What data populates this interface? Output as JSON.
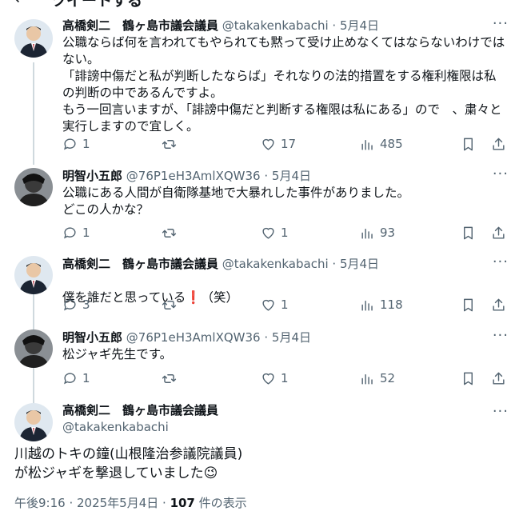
{
  "header": {
    "back_icon": "back-arrow-icon",
    "title": "ツイートする"
  },
  "colors": {
    "text": "#0f1419",
    "muted": "#536471",
    "line": "#cfd9de",
    "accent": "#e0245e"
  },
  "tweets": [
    {
      "name": "高橋剣二　鶴ヶ島市議会議員",
      "handle": "@takakenkabachi",
      "dot": "·",
      "date": "5月4日",
      "more": "···",
      "text": "公職ならば何を言われてもやられても黙って受け止めなくてはならないわけではない。\n「誹謗中傷だと私が判断したならば」それなりの法的措置をする権利権限は私の判断の中であるんですよ。\nもう一回言いますが、「誹謗中傷だと判断する権限は私にある」ので　、粛々と実行しますので宜しく。",
      "reply_count": "1",
      "retweet_count": "",
      "like_count": "17",
      "view_count": "485"
    },
    {
      "name": "明智小五郎",
      "handle": "@76P1eH3AmlXQW36",
      "dot": "·",
      "date": "5月4日",
      "more": "···",
      "text": "公職にある人間が自衛隊基地で大暴れした事件がありました。\nどこの人かな？",
      "reply_count": "1",
      "retweet_count": "",
      "like_count": "1",
      "view_count": "93"
    },
    {
      "name": "高橋剣二　鶴ヶ島市議会議員",
      "handle": "@takakenkabachi",
      "dot": "·",
      "date": "5月4日",
      "more": "···",
      "text_before": "僕を誰だと思っている",
      "text_mark": "❗",
      "text_after": "（笑）",
      "reply_count": "3",
      "retweet_count": "",
      "like_count": "1",
      "view_count": "118"
    },
    {
      "name": "明智小五郎",
      "handle": "@76P1eH3AmlXQW36",
      "dot": "·",
      "date": "5月4日",
      "more": "···",
      "text": "松ジャギ先生です。",
      "reply_count": "1",
      "retweet_count": "",
      "like_count": "1",
      "view_count": "52"
    }
  ],
  "main_tweet": {
    "name": "高橋剣二　鶴ヶ島市議会議員",
    "handle": "@takakenkabachi",
    "more": "···",
    "text": "川越のトキの鐘(山根隆治参議院議員)\nが松ジャギを撃退していました😉",
    "time": "午後9:16 · 2025年5月4日 · ",
    "views_count": "107",
    "views_label": " 件の表示"
  }
}
